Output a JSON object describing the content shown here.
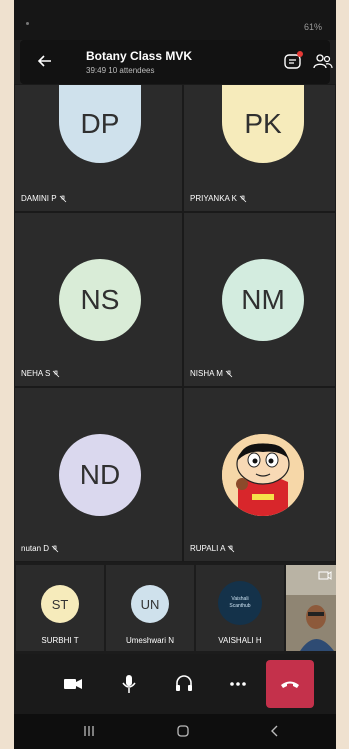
{
  "status": {
    "battery": "61%"
  },
  "header": {
    "title": "Botany Class MVK",
    "subtitle": "39:49  10 attendees"
  },
  "tiles": [
    {
      "initials": "DP",
      "name": "DAMINI P",
      "color": "#cfe1ec"
    },
    {
      "initials": "PK",
      "name": "PRIYANKA K",
      "color": "#f6ebbb"
    },
    {
      "initials": "NS",
      "name": "NEHA S",
      "color": "#d9ecd7"
    },
    {
      "initials": "NM",
      "name": "NISHA M",
      "color": "#d3ecdf"
    },
    {
      "initials": "ND",
      "name": "nutan D",
      "color": "#dad8ee"
    },
    {
      "initials": "",
      "name": "RUPALI A",
      "color": "#f2c98a"
    }
  ],
  "strip": [
    {
      "initials": "ST",
      "name": "SURBHI T",
      "color": "#f6ebbb"
    },
    {
      "initials": "UN",
      "name": "Umeshwari N",
      "color": "#cfe1ec"
    },
    {
      "initials": "",
      "name": "VAISHALI H",
      "color": "#14324a",
      "logo_text": "Vaishali Scanthub"
    }
  ],
  "icons": {
    "back": "arrow-left-icon",
    "chat": "chat-icon",
    "participants": "people-icon",
    "camera": "camera-icon",
    "mic": "microphone-icon",
    "audio": "headset-icon",
    "more": "more-icon",
    "hangup": "phone-hangup-icon"
  },
  "colors": {
    "hangup": "#c4314b",
    "accent_red": "#e53935"
  }
}
